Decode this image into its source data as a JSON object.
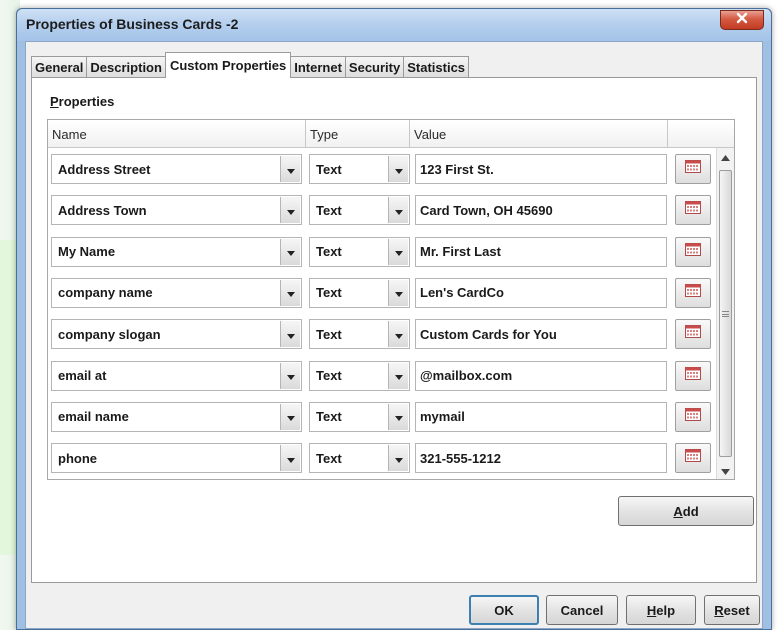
{
  "window": {
    "title": "Properties of Business Cards -2"
  },
  "tabs": [
    {
      "label": "General",
      "active": false
    },
    {
      "label": "Description",
      "active": false
    },
    {
      "label": "Custom Properties",
      "active": true
    },
    {
      "label": "Internet",
      "active": false
    },
    {
      "label": "Security",
      "active": false
    },
    {
      "label": "Statistics",
      "active": false
    }
  ],
  "properties": {
    "section_label_mnemonic": "P",
    "section_label_rest": "roperties",
    "columns": {
      "name": "Name",
      "type": "Type",
      "value": "Value"
    },
    "rows": [
      {
        "name": "Address Street",
        "type": "Text",
        "value": "123 First St."
      },
      {
        "name": "Address Town",
        "type": "Text",
        "value": "Card Town, OH 45690"
      },
      {
        "name": "My Name",
        "type": "Text",
        "value": "Mr. First Last"
      },
      {
        "name": "company name",
        "type": "Text",
        "value": "Len's CardCo"
      },
      {
        "name": "company slogan",
        "type": "Text",
        "value": "Custom Cards for You"
      },
      {
        "name": "email at",
        "type": "Text",
        "value": "@mailbox.com"
      },
      {
        "name": "email name",
        "type": "Text",
        "value": "mymail"
      },
      {
        "name": "phone",
        "type": "Text",
        "value": "321-555-1212"
      }
    ]
  },
  "buttons": {
    "add_mnemonic": "A",
    "add_rest": "dd",
    "ok": "OK",
    "cancel": "Cancel",
    "help_mnemonic": "H",
    "help_rest": "elp",
    "reset_mnemonic": "R",
    "reset_rest": "eset"
  },
  "icons": {
    "close": "close-icon",
    "combo_arrow": "chevron-down-icon",
    "edit_field": "calendar-icon",
    "scroll_up": "scroll-up-icon",
    "scroll_down": "scroll-down-icon"
  },
  "colors": {
    "title_bar": "#b5cfee",
    "close_button": "#d45a42",
    "default_button_border": "#3c7fb1"
  }
}
